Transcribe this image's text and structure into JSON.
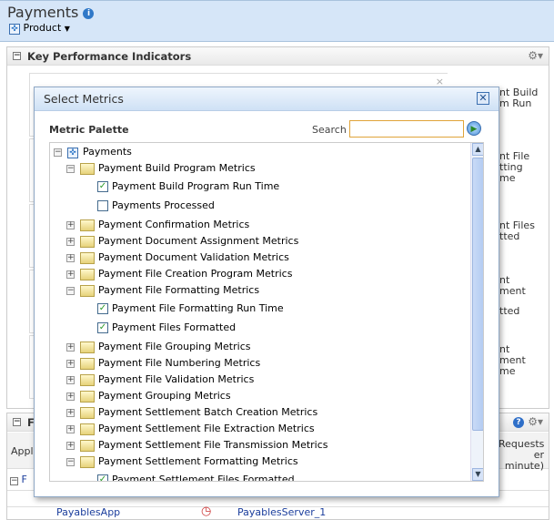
{
  "header": {
    "title": "Payments",
    "menu": "Product"
  },
  "kpi": {
    "title": "Key Performance Indicators",
    "fragments": [
      [
        "nt Build",
        "m Run"
      ],
      [
        "nt File",
        "tting",
        "me"
      ],
      [
        "nt Files",
        "tted"
      ],
      [
        "nt",
        "ment"
      ],
      [
        "tted"
      ],
      [
        "nt",
        "ment",
        "me"
      ]
    ]
  },
  "lower": {
    "title": "F",
    "col_app": "Appli",
    "col_req": [
      "Requests",
      "er minute)"
    ],
    "row1": "F",
    "app": "PayablesApp",
    "server": "PayablesServer_1"
  },
  "dialog": {
    "title": "Select Metrics",
    "palette": "Metric Palette",
    "search_label": "Search",
    "search_value": "",
    "tree": [
      {
        "label": "Payments",
        "type": "root",
        "toggle": "-"
      },
      {
        "label": "Payment Build Program Metrics",
        "type": "folder",
        "toggle": "-"
      },
      {
        "label": "Payment Build Program Run Time",
        "type": "check",
        "checked": true
      },
      {
        "label": "Payments Processed",
        "type": "check",
        "checked": false
      },
      {
        "label": "Payment Confirmation Metrics",
        "type": "folder",
        "toggle": "+"
      },
      {
        "label": "Payment Document Assignment Metrics",
        "type": "folder",
        "toggle": "+"
      },
      {
        "label": "Payment Document Validation Metrics",
        "type": "folder",
        "toggle": "+"
      },
      {
        "label": "Payment File Creation Program Metrics",
        "type": "folder",
        "toggle": "+"
      },
      {
        "label": "Payment File Formatting Metrics",
        "type": "folder",
        "toggle": "-"
      },
      {
        "label": "Payment File Formatting Run Time",
        "type": "check",
        "checked": true
      },
      {
        "label": "Payment Files Formatted",
        "type": "check",
        "checked": true
      },
      {
        "label": "Payment File Grouping Metrics",
        "type": "folder",
        "toggle": "+"
      },
      {
        "label": "Payment File Numbering Metrics",
        "type": "folder",
        "toggle": "+"
      },
      {
        "label": "Payment File Validation Metrics",
        "type": "folder",
        "toggle": "+"
      },
      {
        "label": "Payment Grouping Metrics",
        "type": "folder",
        "toggle": "+"
      },
      {
        "label": "Payment Settlement Batch Creation Metrics",
        "type": "folder",
        "toggle": "+"
      },
      {
        "label": "Payment Settlement File Extraction Metrics",
        "type": "folder",
        "toggle": "+"
      },
      {
        "label": "Payment Settlement File Transmission Metrics",
        "type": "folder",
        "toggle": "+"
      },
      {
        "label": "Payment Settlement Formatting Metrics",
        "type": "folder",
        "toggle": "-"
      },
      {
        "label": "Payment Settlement Files Formatted",
        "type": "check",
        "checked": true
      }
    ]
  }
}
